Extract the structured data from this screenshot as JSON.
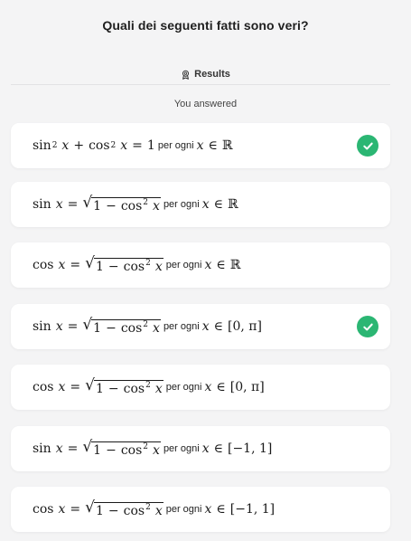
{
  "question": {
    "title": "Quali dei seguenti fatti sono veri?"
  },
  "results": {
    "label": "Results",
    "icon": "award-icon",
    "answered_label": "You answered"
  },
  "common": {
    "per_ogni": "per ogni",
    "x": "x",
    "sin": "sin",
    "cos": "cos",
    "eq": "=",
    "in": "∈",
    "plus": "+",
    "one": "1",
    "minus": "−",
    "sq": "2",
    "sqrt": "√"
  },
  "options": [
    {
      "id": "opt-1",
      "domain": "ℝ",
      "correct": true
    },
    {
      "id": "opt-2",
      "domain": "ℝ",
      "correct": false
    },
    {
      "id": "opt-3",
      "domain": "ℝ",
      "correct": false
    },
    {
      "id": "opt-4",
      "domain": "[0, π]",
      "correct": true
    },
    {
      "id": "opt-5",
      "domain": "[0, π]",
      "correct": false
    },
    {
      "id": "opt-6",
      "domain": "[−1, 1]",
      "correct": false
    },
    {
      "id": "opt-7",
      "domain": "[−1, 1]",
      "correct": false
    }
  ],
  "colors": {
    "correct": "#2bb673",
    "background": "#f4f4f5",
    "card": "#ffffff"
  }
}
